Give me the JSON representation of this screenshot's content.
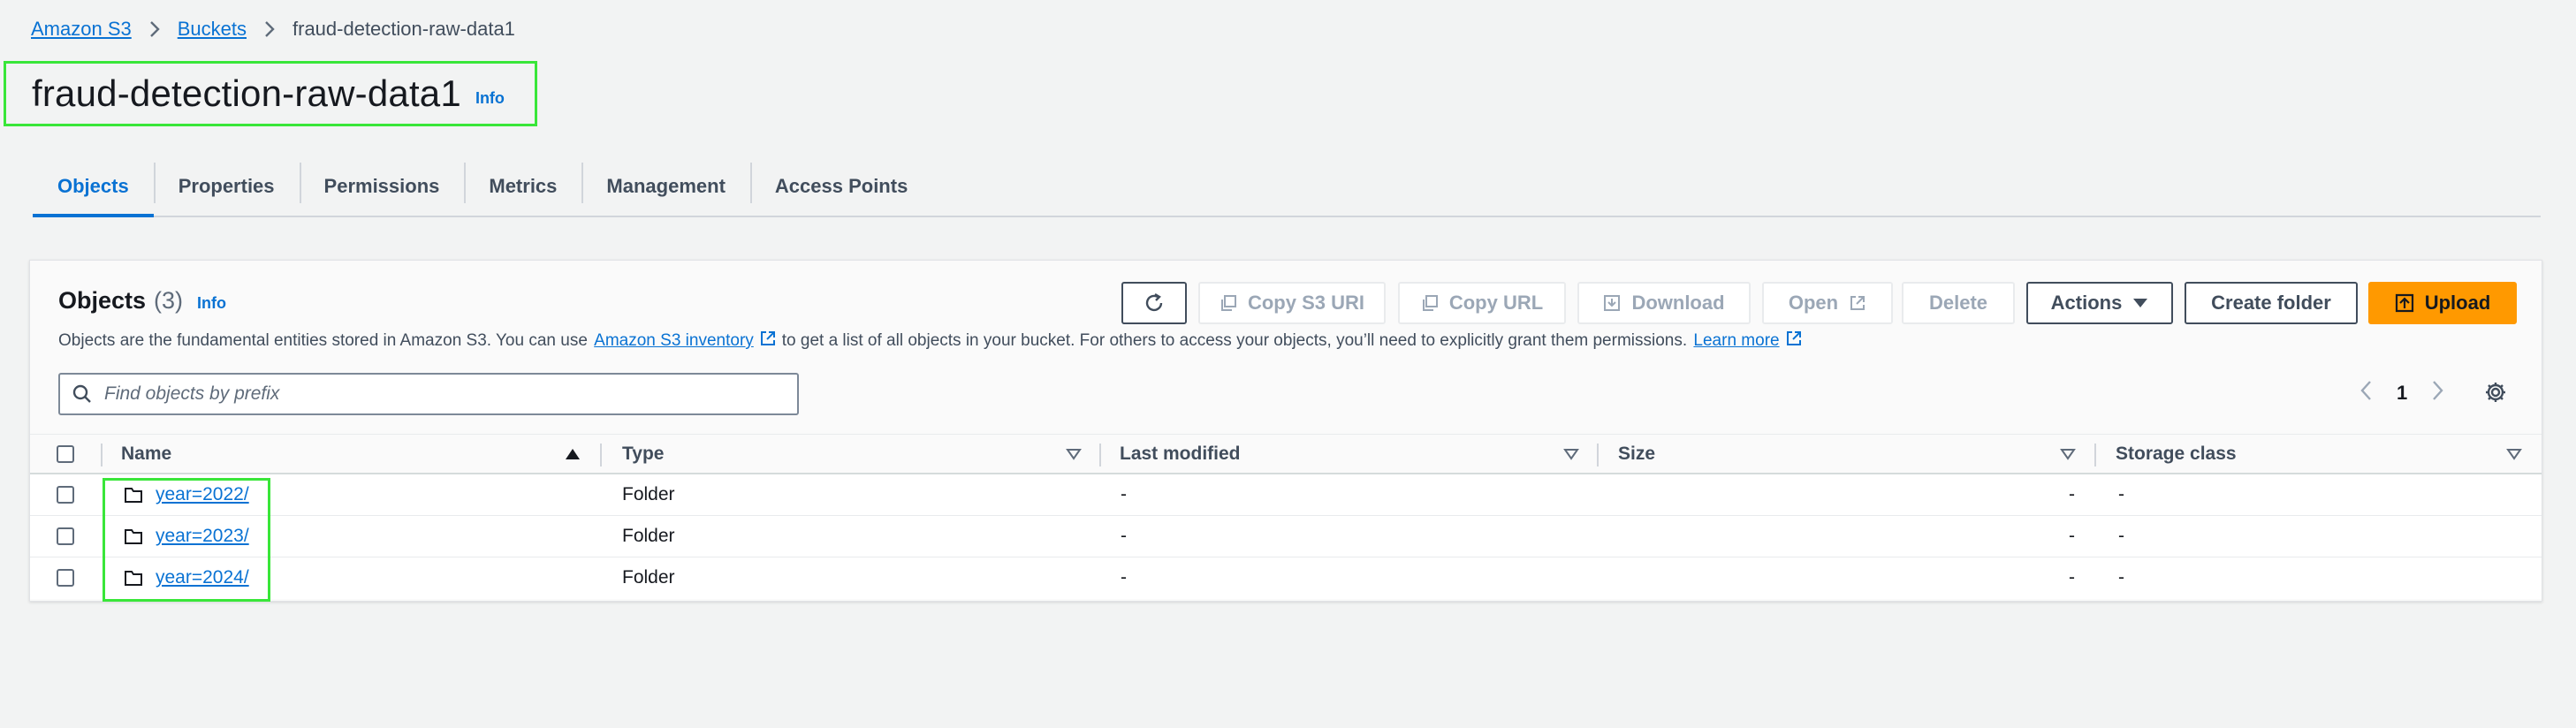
{
  "breadcrumb": {
    "items": [
      "Amazon S3",
      "Buckets"
    ],
    "current": "fraud-detection-raw-data1"
  },
  "page": {
    "title": "fraud-detection-raw-data1",
    "info": "Info"
  },
  "tabs": [
    "Objects",
    "Properties",
    "Permissions",
    "Metrics",
    "Management",
    "Access Points"
  ],
  "objects_panel": {
    "title": "Objects",
    "count": "(3)",
    "info": "Info",
    "desc_before": "Objects are the fundamental entities stored in Amazon S3. You can use",
    "desc_link": "Amazon S3 inventory",
    "desc_after": "to get a list of all objects in your bucket. For others to access your objects, you’ll need to explicitly grant them permissions.",
    "learn_more": "Learn more",
    "buttons": {
      "copy_s3_uri": "Copy S3 URI",
      "copy_url": "Copy URL",
      "download": "Download",
      "open": "Open",
      "delete": "Delete",
      "actions": "Actions",
      "create_folder": "Create folder",
      "upload": "Upload"
    },
    "search_placeholder": "Find objects by prefix",
    "page_number": "1",
    "columns": [
      "Name",
      "Type",
      "Last modified",
      "Size",
      "Storage class"
    ],
    "rows": [
      {
        "name": "year=2022/",
        "type": "Folder",
        "last_modified": "-",
        "size": "-",
        "storage_class": "-"
      },
      {
        "name": "year=2023/",
        "type": "Folder",
        "last_modified": "-",
        "size": "-",
        "storage_class": "-"
      },
      {
        "name": "year=2024/",
        "type": "Folder",
        "last_modified": "-",
        "size": "-",
        "storage_class": "-"
      }
    ]
  },
  "colors": {
    "link": "#0972d3",
    "primary": "#ff9900",
    "highlight": "#39e639"
  }
}
